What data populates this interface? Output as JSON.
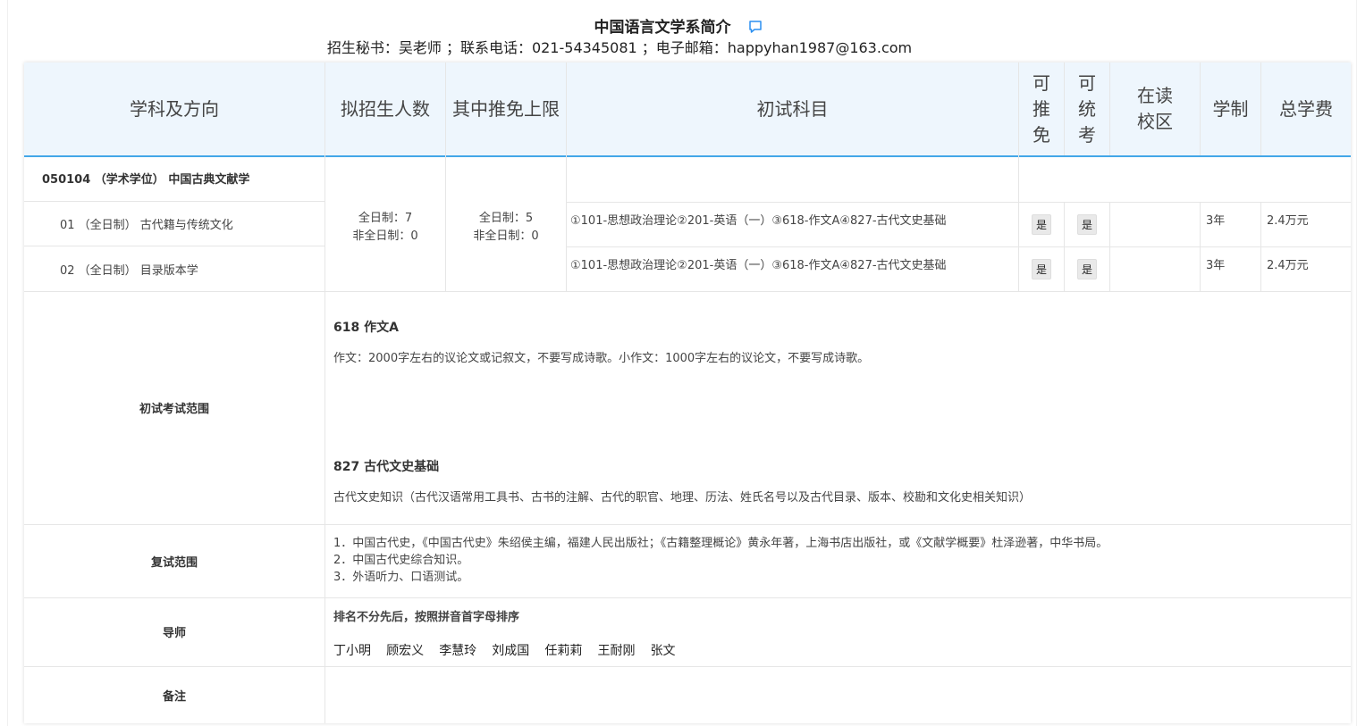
{
  "header": {
    "title": "中国语言文学系简介",
    "contact": "招生秘书：吴老师 ；联系电话：021-54345081 ；电子邮箱：happyhan1987@163.com"
  },
  "columns": {
    "subject": "学科及方向",
    "planned": "拟招生人数",
    "exempt_limit": "其中推免上限",
    "exam_subjects": "初试科目",
    "can_exempt": "可推免",
    "can_unified": "可统考",
    "campus": "在读校区",
    "duration": "学制",
    "tuition": "总学费"
  },
  "program": {
    "code_title": "050104 （学术学位） 中国古典文献学",
    "planned": {
      "full": "全日制：7",
      "part": "非全日制：0"
    },
    "exempt_limit": {
      "full": "全日制：5",
      "part": "非全日制：0"
    },
    "directions": [
      {
        "name": "01 （全日制） 古代籍与传统文化",
        "subjects": "①101-思想政治理论②201-英语（一）③618-作文A④827-古代文史基础",
        "can_exempt": "是",
        "can_unified": "是",
        "campus": "",
        "duration": "3年",
        "tuition": "2.4万元"
      },
      {
        "name": "02 （全日制） 目录版本学",
        "subjects": "①101-思想政治理论②201-英语（一）③618-作文A④827-古代文史基础",
        "can_exempt": "是",
        "can_unified": "是",
        "campus": "",
        "duration": "3年",
        "tuition": "2.4万元"
      }
    ]
  },
  "exam_scope": {
    "label": "初试考试范围",
    "s1_title": "618 作文A",
    "s1_text": "作文：2000字左右的议论文或记叙文，不要写成诗歌。小作文：1000字左右的议论文，不要写成诗歌。",
    "s2_title": "827 古代文史基础",
    "s2_text": "古代文史知识（古代汉语常用工具书、古书的注解、古代的职官、地理、历法、姓氏名号以及古代目录、版本、校勘和文化史相关知识）"
  },
  "retest": {
    "label": "复试范围",
    "items": [
      "1．中国古代史，《中国古代史》朱绍侯主编，福建人民出版社；《古籍整理概论》黄永年著，上海书店出版社，或《文献学概要》杜泽逊著，中华书局。",
      "2．中国古代史综合知识。",
      "3．外语听力、口语测试。"
    ]
  },
  "advisors": {
    "label": "导师",
    "note": "排名不分先后，按照拼音首字母排序",
    "names": [
      "丁小明",
      "顾宏义",
      "李慧玲",
      "刘成国",
      "任莉莉",
      "王耐刚",
      "张文"
    ]
  },
  "remarks": {
    "label": "备注",
    "text": ""
  },
  "icons": {
    "comment": "comment-icon"
  },
  "colors": {
    "header_bg": "#eef6fd",
    "accent": "#43a7e8",
    "icon": "#2b8ff0"
  }
}
